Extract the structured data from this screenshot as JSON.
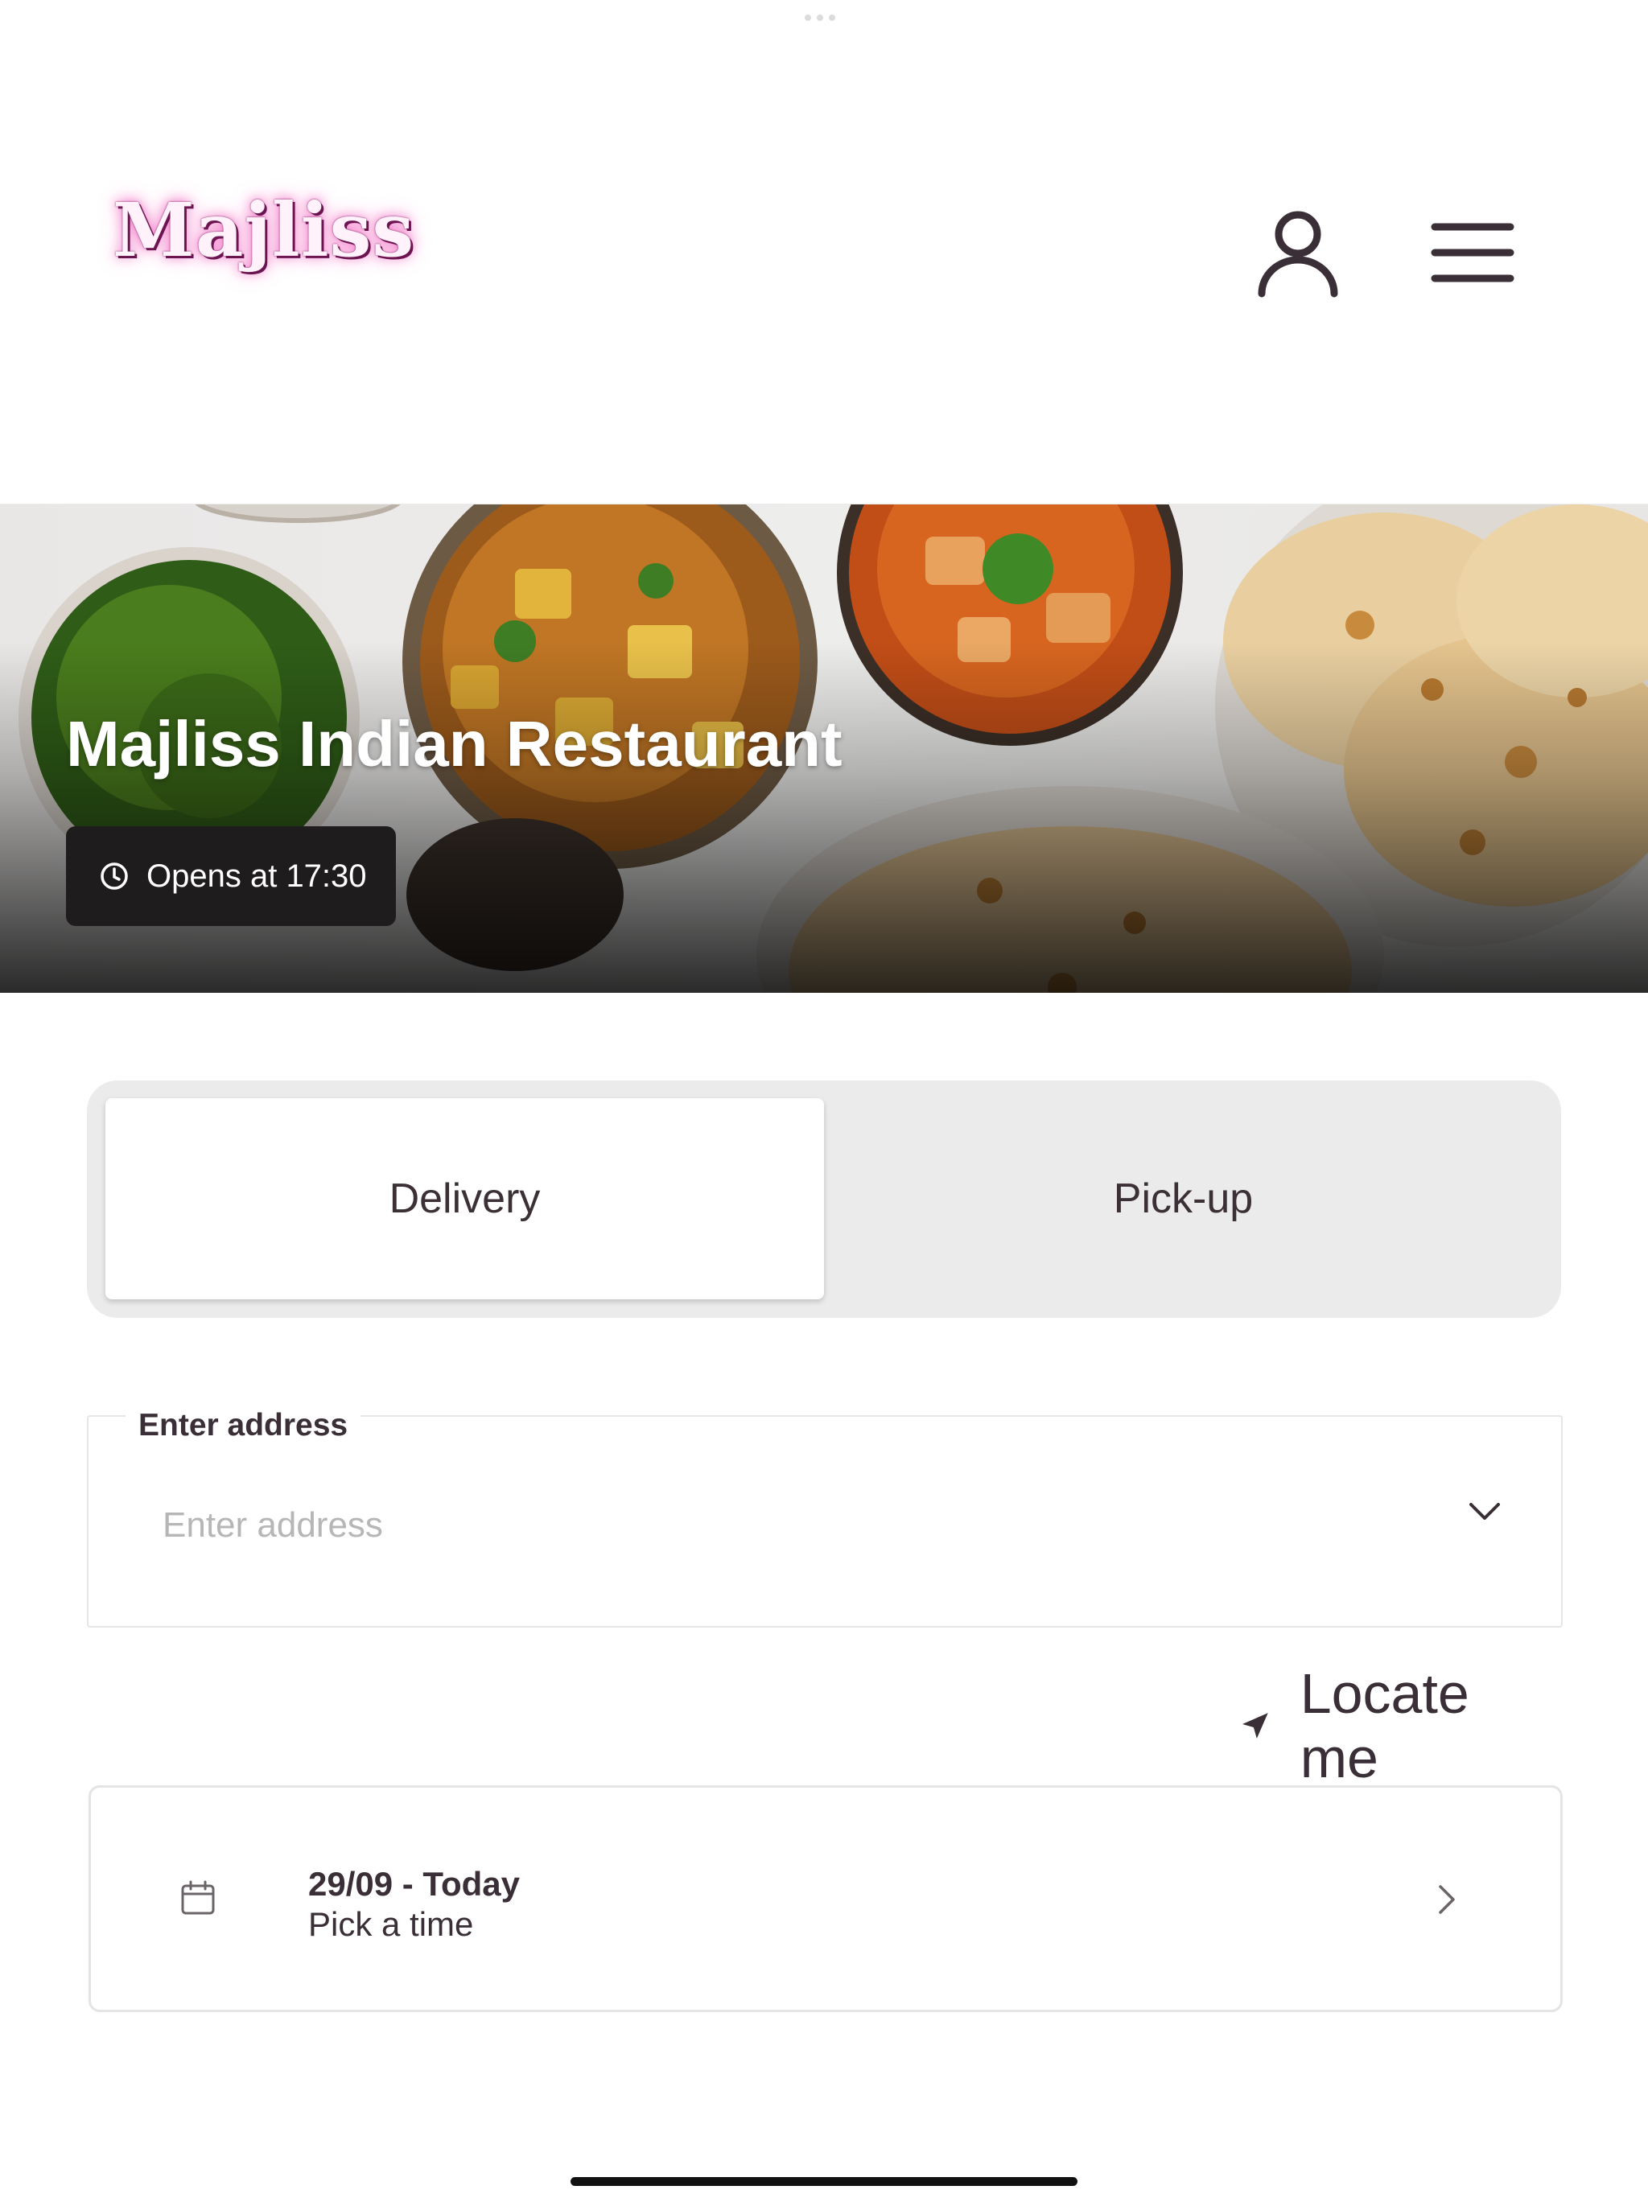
{
  "header": {
    "logo_text": "Majliss",
    "account_icon": "user-icon",
    "menu_icon": "hamburger-menu-icon"
  },
  "hero": {
    "title": "Majliss Indian Restaurant",
    "hours_badge": "Opens at 17:30",
    "hours_icon": "clock-icon"
  },
  "order_mode": {
    "options": [
      "Delivery",
      "Pick-up"
    ],
    "selected": "Delivery"
  },
  "address": {
    "label": "Enter address",
    "placeholder": "Enter address",
    "value": "",
    "dropdown_icon": "chevron-down-icon"
  },
  "locate": {
    "label": "Locate me",
    "icon": "location-arrow-icon"
  },
  "schedule": {
    "date_label": "29/09 - Today",
    "time_label": "Pick a time",
    "icon": "calendar-icon",
    "chevron_icon": "chevron-right-icon"
  },
  "colors": {
    "text": "#3a2f36",
    "toggle_bg": "#ebebeb",
    "badge_bg": "#1e1c1d",
    "logo_glow": "#f27ac9"
  }
}
